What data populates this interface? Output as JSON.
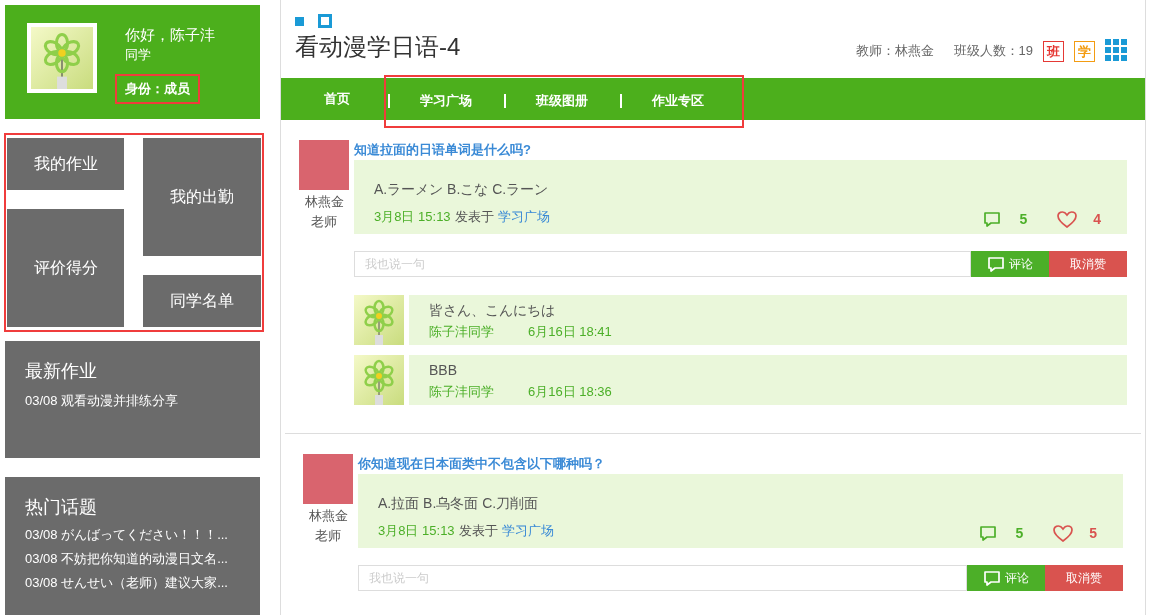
{
  "profile": {
    "greeting": "你好，陈子沣",
    "role": "同学",
    "identity": "身份：成员"
  },
  "tiles": [
    {
      "label": "我的作业"
    },
    {
      "label": "我的出勤"
    },
    {
      "label": "评价得分"
    },
    {
      "label": "同学名单"
    }
  ],
  "latest_homework": {
    "title": "最新作业",
    "items": [
      "03/08 观看动漫并排练分享"
    ]
  },
  "hot_topics": {
    "title": "热门话题",
    "items": [
      "03/08 がんばってください！！！...",
      "03/08 不妨把你知道的动漫日文名...",
      "03/08 せんせい（老师）建议大家..."
    ]
  },
  "class": {
    "title": "看动漫学日语-4",
    "teacher": "教师：林燕金",
    "member_count": "班级人数：19",
    "badges": [
      {
        "label": "班",
        "color": "#e53935"
      },
      {
        "label": "学",
        "color": "#f39c12"
      }
    ]
  },
  "nav": [
    "首页",
    "学习广场",
    "班级图册",
    "作业专区"
  ],
  "posts": [
    {
      "author": "林燕金",
      "role": "老师",
      "title": "知道拉面的日语单词是什么吗?",
      "options": "A.ラーメン B.こな C.ラーン",
      "date": "3月8日 15:13",
      "posted_in": "发表于",
      "board": "学习广场",
      "comments": "5",
      "likes": "4",
      "placeholder": "我也说一句",
      "comment_button": "评论",
      "unlike_button": "取消赞",
      "replies": [
        {
          "text": "皆さん、こんにちは",
          "author": "陈子沣同学",
          "time": "6月16日 18:41"
        },
        {
          "text": "BBB",
          "author": "陈子沣同学",
          "time": "6月16日 18:36"
        }
      ]
    },
    {
      "author": "林燕金",
      "role": "老师",
      "title": "你知道现在日本面类中不包含以下哪种吗？",
      "options": "A.拉面 B.乌冬面 C.刀削面",
      "date": "3月8日 15:13",
      "posted_in": "发表于",
      "board": "学习广场",
      "comments": "5",
      "likes": "5",
      "placeholder": "我也说一句",
      "comment_button": "评论",
      "unlike_button": "取消赞"
    }
  ]
}
